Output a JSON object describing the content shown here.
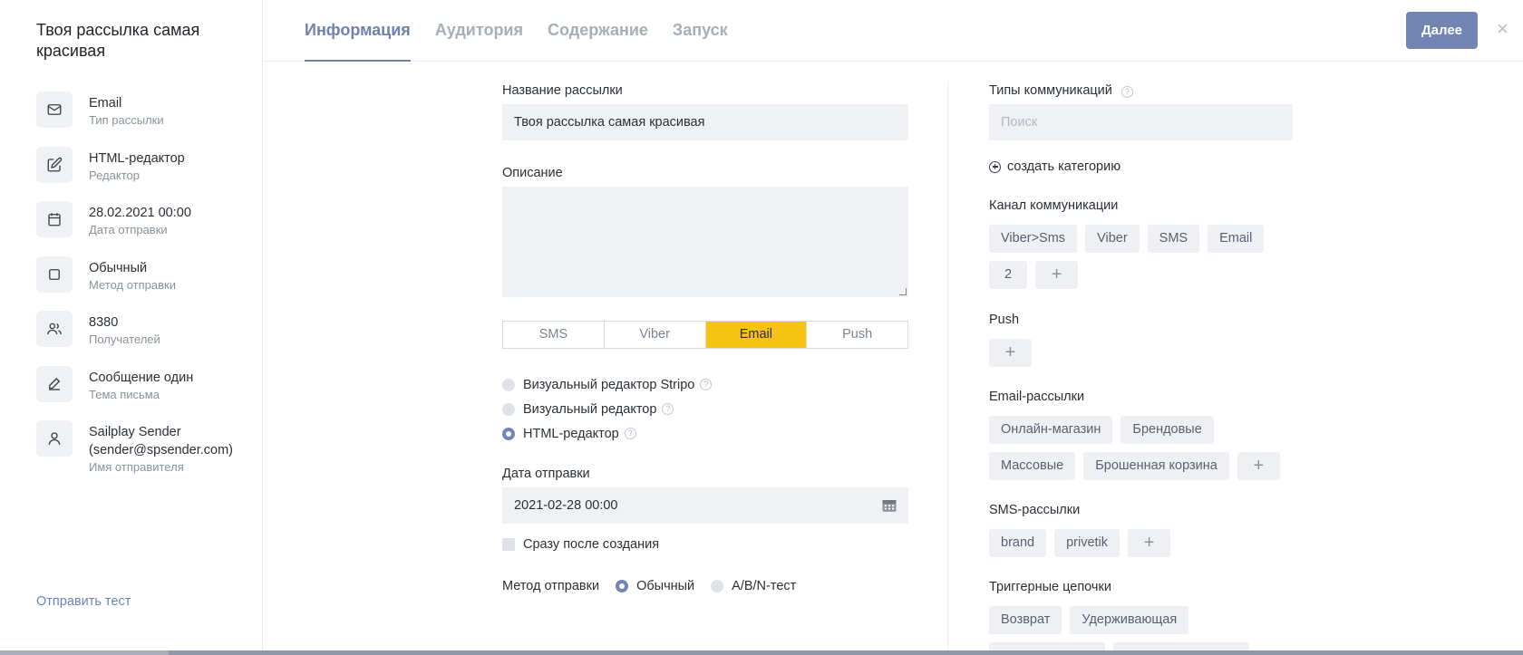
{
  "sidebar": {
    "title": "Твоя рассылка самая красивая",
    "items": [
      {
        "icon": "mail-icon",
        "value": "Email",
        "label": "Тип рассылки"
      },
      {
        "icon": "edit-icon",
        "value": "HTML-редактор",
        "label": "Редактор"
      },
      {
        "icon": "calendar-icon",
        "value": "28.02.2021 00:00",
        "label": "Дата отправки"
      },
      {
        "icon": "square-icon",
        "value": "Обычный",
        "label": "Метод отправки"
      },
      {
        "icon": "users-icon",
        "value": "8380",
        "label": "Получателей"
      },
      {
        "icon": "pen-icon",
        "value": "Сообщение один",
        "label": "Тема письма"
      },
      {
        "icon": "user-icon",
        "value": "Sailplay Sender (sender@spsender.com)",
        "label": "Имя отправителя"
      }
    ],
    "send_test": "Отправить тест"
  },
  "header": {
    "tabs": [
      "Информация",
      "Аудитория",
      "Содержание",
      "Запуск"
    ],
    "active_tab": "Информация",
    "next_button": "Далее",
    "close": "×"
  },
  "form": {
    "name_label": "Название рассылки",
    "name_value": "Твоя рассылка самая красивая",
    "description_label": "Описание",
    "channels": [
      "SMS",
      "Viber",
      "Email",
      "Push"
    ],
    "active_channel": "Email",
    "editors": [
      {
        "label": "Визуальный редактор Stripo",
        "selected": false
      },
      {
        "label": "Визуальный редактор",
        "selected": false
      },
      {
        "label": "HTML-редактор",
        "selected": true
      }
    ],
    "date_label": "Дата отправки",
    "date_value": "2021-02-28 00:00",
    "immediately_label": "Сразу после создания",
    "method_label": "Метод отправки",
    "methods": [
      {
        "label": "Обычный",
        "selected": true
      },
      {
        "label": "A/B/N-тест",
        "selected": false
      }
    ],
    "help_glyph": "?"
  },
  "right": {
    "types_label": "Типы коммуникаций",
    "search_placeholder": "Поиск",
    "create_category": "создать категорию",
    "channel_label": "Канал коммуникации",
    "channel_chips": [
      "Viber>Sms",
      "Viber",
      "SMS",
      "Email",
      "2"
    ],
    "push_label": "Push",
    "email_label": "Email-рассылки",
    "email_chips": [
      "Онлайн-магазин",
      "Брендовые",
      "Массовые",
      "Брошенная корзина"
    ],
    "sms_label": "SMS-рассылки",
    "sms_chips": [
      "brand",
      "privetik"
    ],
    "trigger_label": "Триггерные цепочки",
    "trigger_chips": [
      "Возврат",
      "Удерживающая"
    ],
    "plus_glyph": "+"
  }
}
